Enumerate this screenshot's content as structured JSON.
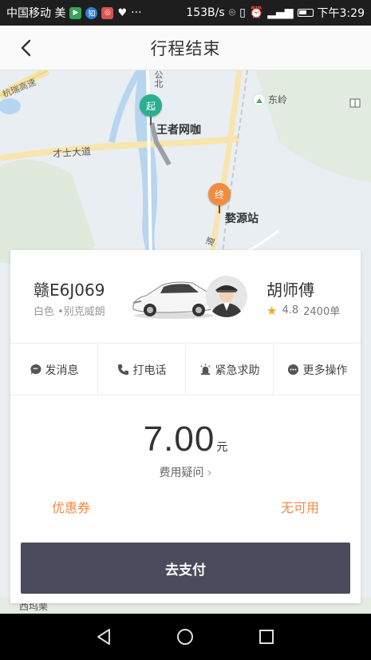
{
  "status_bar": {
    "carrier": "中国移动 美",
    "speed": "153B/s",
    "time": "下午3:29",
    "app_icons": [
      "app-green-icon",
      "app-blue-icon",
      "app-red-icon",
      "heart-icon"
    ],
    "overflow": "···"
  },
  "header": {
    "title": "行程结束",
    "back_icon": "chevron-left-icon"
  },
  "map": {
    "labels": {
      "start_place": "王者网咖",
      "end_place": "婺源站",
      "poi_dongling": "东岭",
      "road_caishi": "才士大道",
      "road_hangrui": "杭瑞高速",
      "bottom_poi": "西坞栗",
      "river_text": "公北",
      "road_vertical": "道"
    },
    "start_marker": "起",
    "end_marker": "终",
    "colors": {
      "start": "#2bb08f",
      "end": "#f28c3f",
      "water": "#b6d4ee",
      "road": "#f7e7b6"
    }
  },
  "driver": {
    "plate": "赣E6J069",
    "car": "白色 •别克威朗",
    "name": "胡师傅",
    "rating": "4.8",
    "orders": "2400单"
  },
  "actions": [
    {
      "label": "发消息",
      "icon": "message-icon"
    },
    {
      "label": "打电话",
      "icon": "phone-icon"
    },
    {
      "label": "紧急求助",
      "icon": "alarm-icon"
    },
    {
      "label": "更多操作",
      "icon": "more-icon"
    }
  ],
  "fare": {
    "amount": "7.00",
    "unit": "元",
    "question": "费用疑问",
    "question_arrow": "›"
  },
  "coupon": {
    "label": "优惠券",
    "value": "无可用"
  },
  "pay_button": "去支付",
  "colors": {
    "accent": "#f08a46",
    "pay_button": "#4a4b5c",
    "star": "#f5a623"
  }
}
